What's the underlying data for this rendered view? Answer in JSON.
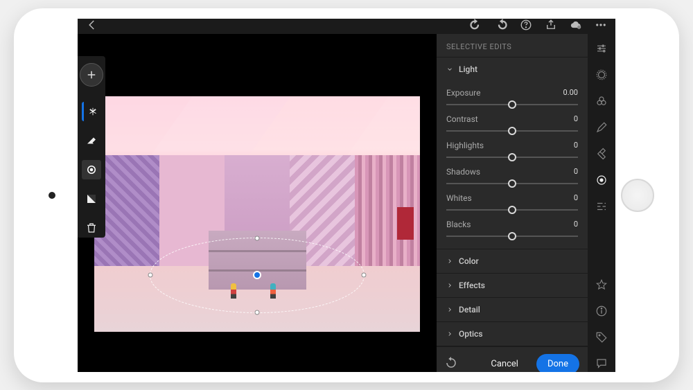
{
  "topbar": {
    "redo_icon": "redo",
    "undo_icon": "undo",
    "help_icon": "help",
    "share_icon": "share",
    "cloud_icon": "cloud-sync",
    "more_icon": "more"
  },
  "toolrail": {
    "add_label": "+",
    "tools": [
      "asterisk",
      "eraser",
      "radial-filter",
      "gradient-filter"
    ],
    "trash": "trash"
  },
  "panel": {
    "title": "SELECTIVE EDITS",
    "sections": {
      "light": {
        "label": "Light",
        "expanded": true,
        "sliders": [
          {
            "name": "Exposure",
            "value": "0.00",
            "pos": 50
          },
          {
            "name": "Contrast",
            "value": "0",
            "pos": 50
          },
          {
            "name": "Highlights",
            "value": "0",
            "pos": 50
          },
          {
            "name": "Shadows",
            "value": "0",
            "pos": 50
          },
          {
            "name": "Whites",
            "value": "0",
            "pos": 50
          },
          {
            "name": "Blacks",
            "value": "0",
            "pos": 50
          }
        ]
      },
      "collapsed": [
        {
          "label": "Color"
        },
        {
          "label": "Effects"
        },
        {
          "label": "Detail"
        },
        {
          "label": "Optics"
        }
      ]
    }
  },
  "footer": {
    "cancel": "Cancel",
    "done": "Done"
  },
  "rightstrip": {
    "top": [
      "adjust",
      "crop",
      "presets",
      "brush",
      "heal",
      "selective",
      "geometry"
    ],
    "bottom": [
      "star",
      "info",
      "tag",
      "comments"
    ]
  }
}
